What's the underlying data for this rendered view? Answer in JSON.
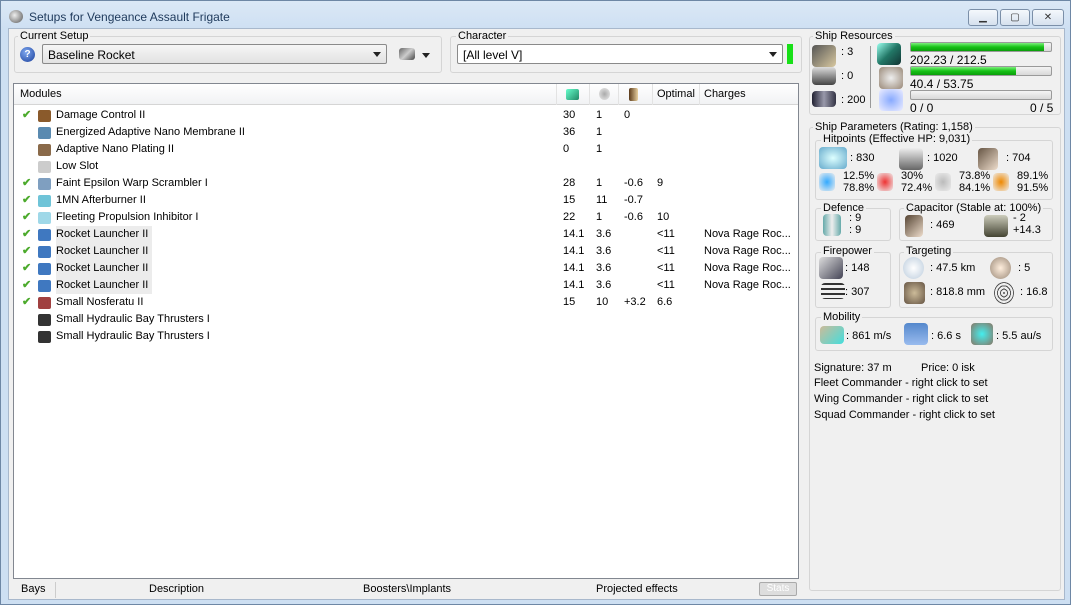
{
  "window": {
    "title": "Setups for Vengeance Assault Frigate",
    "buttons": {
      "minimize": "▁",
      "maximize": "▢",
      "close": "✕"
    }
  },
  "setup": {
    "label": "Current Setup",
    "value": "Baseline Rocket"
  },
  "character": {
    "label": "Character",
    "value": "[All level V]"
  },
  "modules": {
    "headers": {
      "name": "Modules",
      "optimal": "Optimal",
      "charges": "Charges"
    },
    "header_icons": [
      "cpu-icon",
      "powergrid-icon",
      "capacitor-icon"
    ],
    "rows": [
      {
        "checked": true,
        "name": "Damage Control II",
        "cpu": "30",
        "pg": "1",
        "cap": "0",
        "optimal": "",
        "charges": "",
        "icon": "#8a5a2b"
      },
      {
        "checked": false,
        "name": "Energized Adaptive Nano Membrane II",
        "cpu": "36",
        "pg": "1",
        "cap": "",
        "optimal": "",
        "charges": "",
        "icon": "#5a8ab0"
      },
      {
        "checked": false,
        "name": "Adaptive Nano Plating II",
        "cpu": "0",
        "pg": "1",
        "cap": "",
        "optimal": "",
        "charges": "",
        "icon": "#8a6a4a"
      },
      {
        "checked": false,
        "name": "Low Slot",
        "cpu": "",
        "pg": "",
        "cap": "",
        "optimal": "",
        "charges": "",
        "icon": "#cccccc"
      },
      {
        "checked": true,
        "name": "Faint Epsilon Warp Scrambler I",
        "cpu": "28",
        "pg": "1",
        "cap": "-0.6",
        "optimal": "9",
        "charges": "",
        "icon": "#7f9fc0"
      },
      {
        "checked": true,
        "name": "1MN Afterburner II",
        "cpu": "15",
        "pg": "11",
        "cap": "-0.7",
        "optimal": "",
        "charges": "",
        "icon": "#6fc4d8"
      },
      {
        "checked": true,
        "name": "Fleeting Propulsion Inhibitor I",
        "cpu": "22",
        "pg": "1",
        "cap": "-0.6",
        "optimal": "10",
        "charges": "",
        "icon": "#9fd8e8"
      },
      {
        "checked": true,
        "name": "Rocket Launcher II",
        "cpu": "14.1",
        "pg": "3.6",
        "cap": "",
        "optimal": "<11",
        "charges": "Nova Rage Roc...",
        "icon": "#3f78c0",
        "hl": true
      },
      {
        "checked": true,
        "name": "Rocket Launcher II",
        "cpu": "14.1",
        "pg": "3.6",
        "cap": "",
        "optimal": "<11",
        "charges": "Nova Rage Roc...",
        "icon": "#3f78c0",
        "hl": true
      },
      {
        "checked": true,
        "name": "Rocket Launcher II",
        "cpu": "14.1",
        "pg": "3.6",
        "cap": "",
        "optimal": "<11",
        "charges": "Nova Rage Roc...",
        "icon": "#3f78c0",
        "hl": true
      },
      {
        "checked": true,
        "name": "Rocket Launcher II",
        "cpu": "14.1",
        "pg": "3.6",
        "cap": "",
        "optimal": "<11",
        "charges": "Nova Rage Roc...",
        "icon": "#3f78c0",
        "hl": true
      },
      {
        "checked": true,
        "name": "Small Nosferatu II",
        "cpu": "15",
        "pg": "10",
        "cap": "+3.2",
        "optimal": "6.6",
        "charges": "",
        "icon": "#a04040"
      },
      {
        "checked": false,
        "name": "Small Hydraulic Bay Thrusters I",
        "cpu": "",
        "pg": "",
        "cap": "",
        "optimal": "",
        "charges": "",
        "icon": "#333333"
      },
      {
        "checked": false,
        "name": "Small Hydraulic Bay Thrusters I",
        "cpu": "",
        "pg": "",
        "cap": "",
        "optimal": "",
        "charges": "",
        "icon": "#333333"
      }
    ]
  },
  "tabs": {
    "bays": "Bays",
    "description": "Description",
    "boosters": "Boosters\\Implants",
    "projected": "Projected effects",
    "stats": "Stats"
  },
  "resources": {
    "label": "Ship Resources",
    "turrets": ": 3",
    "launchers": ": 0",
    "drone_bay": ": 200",
    "cpu": {
      "text": "202.23 / 212.5",
      "fraction": 0.952
    },
    "powergrid": {
      "text": "40.4 / 53.75",
      "fraction": 0.752
    },
    "drones": {
      "text": "0 / 0",
      "slots": "0 / 5",
      "fraction": 0
    }
  },
  "params": {
    "label": "Ship Parameters (Rating: 1,158)",
    "hitpoints": {
      "label": "Hitpoints (Effective HP: 9,031)",
      "shield": ": 830",
      "armor": ": 1020",
      "structure": ": 704",
      "resists": [
        {
          "a": "12.5%",
          "b": "78.8%"
        },
        {
          "a": "30%",
          "b": "72.4%"
        },
        {
          "a": "73.8%",
          "b": "84.1%"
        },
        {
          "a": "89.1%",
          "b": "91.5%"
        }
      ]
    },
    "defence": {
      "label": "Defence",
      "a": ": 9",
      "b": ": 9"
    },
    "capacitor": {
      "label": "Capacitor (Stable at: 100%)",
      "amount": ": 469",
      "delta_a": "- 2",
      "delta_b": "+14.3"
    },
    "firepower": {
      "label": "Firepower",
      "a": ": 148",
      "b": ": 307"
    },
    "targeting": {
      "label": "Targeting",
      "range": ": 47.5 km",
      "targets": ": 5",
      "resolution": ": 818.8 mm",
      "sensor": ": 16.8"
    },
    "mobility": {
      "label": "Mobility",
      "speed": ": 861 m/s",
      "align": ": 6.6 s",
      "warp": ": 5.5 au/s"
    }
  },
  "footer": {
    "signature": "Signature: 37 m",
    "price": "Price: 0 isk",
    "fleet": "Fleet Commander - right click to set",
    "wing": "Wing Commander - right click to set",
    "squad": "Squad Commander - right click to set"
  },
  "colors": {
    "bar_fill": "#16c216",
    "check": "#4caa2c"
  }
}
